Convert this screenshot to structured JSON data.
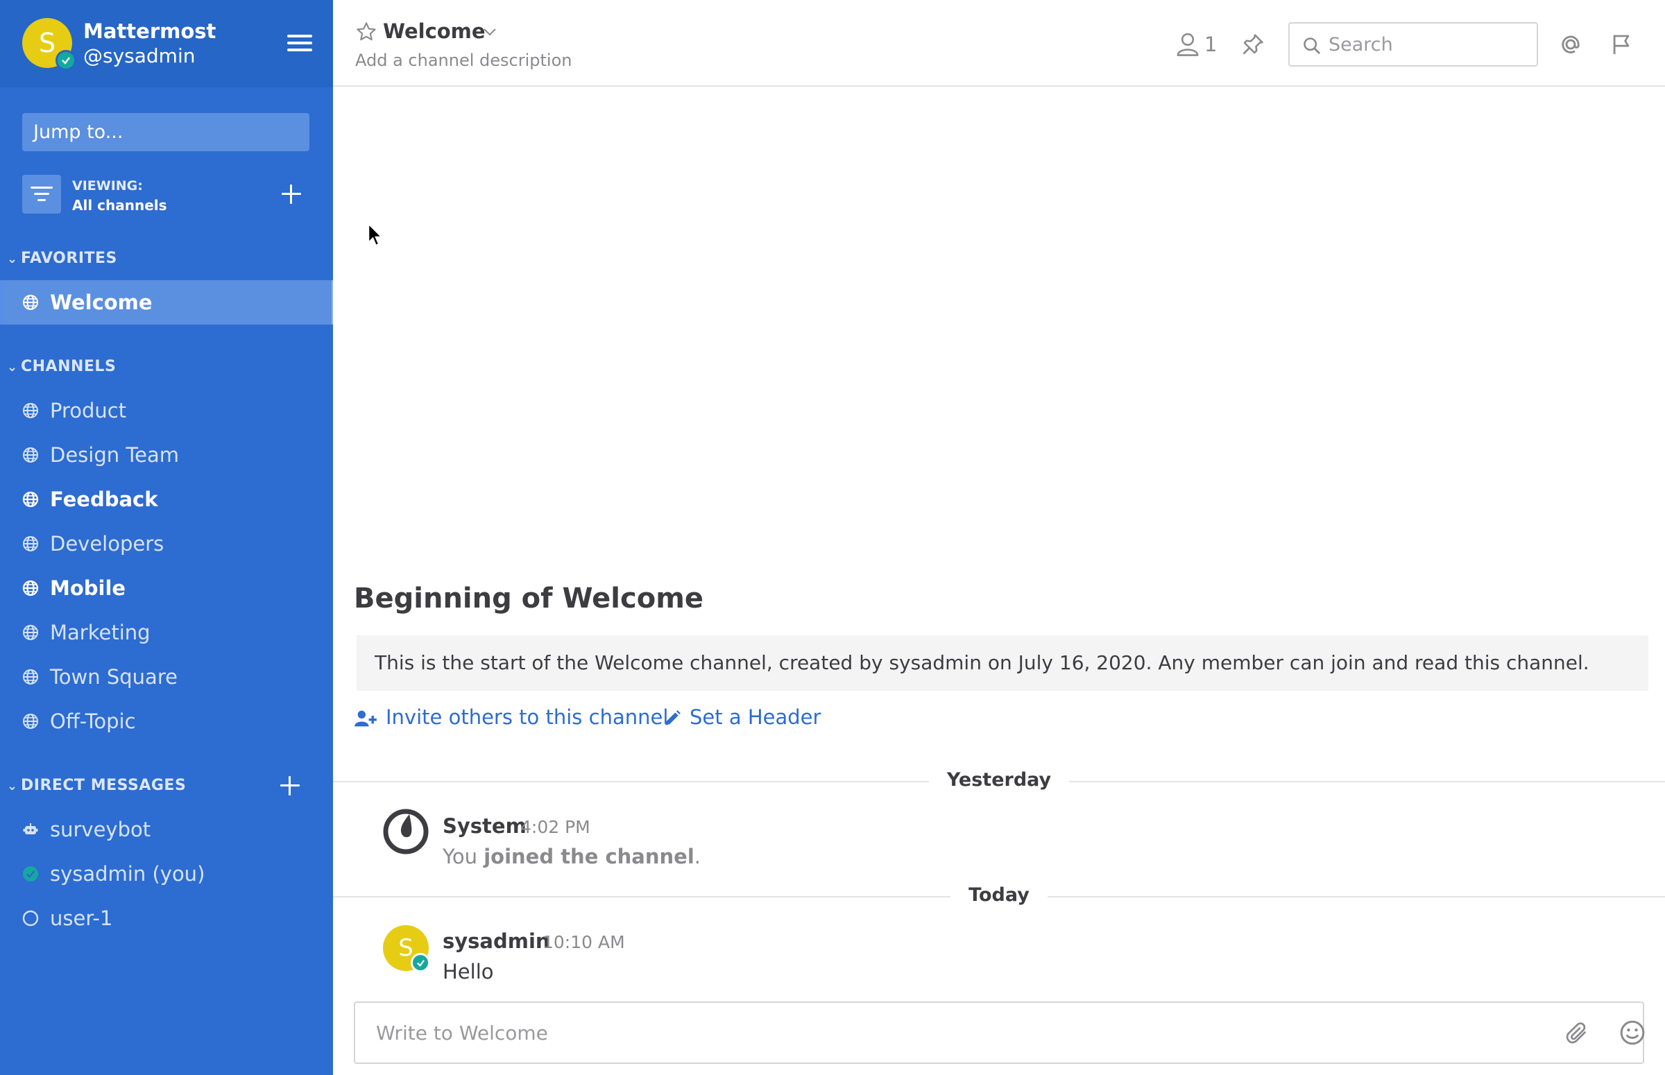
{
  "team": {
    "avatar_letter": "S",
    "name": "Mattermost",
    "username": "@sysadmin"
  },
  "sidebar": {
    "jump_to_placeholder": "Jump to...",
    "viewing_label": "VIEWING:",
    "viewing_value": "All channels",
    "favorites_header": "FAVORITES",
    "favorites": [
      {
        "label": "Welcome",
        "icon": "globe-icon",
        "active": true
      }
    ],
    "channels_header": "CHANNELS",
    "channels": [
      {
        "label": "Product",
        "icon": "globe-icon",
        "unread": false
      },
      {
        "label": "Design Team",
        "icon": "globe-icon",
        "unread": false
      },
      {
        "label": "Feedback",
        "icon": "globe-icon",
        "unread": true
      },
      {
        "label": "Developers",
        "icon": "globe-icon",
        "unread": false
      },
      {
        "label": "Mobile",
        "icon": "globe-icon",
        "unread": true
      },
      {
        "label": "Marketing",
        "icon": "globe-icon",
        "unread": false
      },
      {
        "label": "Town Square",
        "icon": "globe-icon",
        "unread": false
      },
      {
        "label": "Off-Topic",
        "icon": "globe-icon",
        "unread": false
      }
    ],
    "dm_header": "DIRECT MESSAGES",
    "direct_messages": [
      {
        "label": "surveybot",
        "icon": "bot-icon"
      },
      {
        "label": "sysadmin (you)",
        "icon": "online-status-icon"
      },
      {
        "label": "user-1",
        "icon": "offline-status-icon"
      }
    ]
  },
  "header": {
    "channel_name": "Welcome",
    "description": "Add a channel description",
    "member_count": "1",
    "search_placeholder": "Search"
  },
  "intro": {
    "title": "Beginning of Welcome",
    "text": "This is the start of the Welcome channel, created by sysadmin on July 16, 2020. Any member can join and read this channel.",
    "invite_label": "Invite others to this channel",
    "set_header_label": "Set a Header"
  },
  "posts": {
    "yesterday_label": "Yesterday",
    "system": {
      "name": "System",
      "time": "4:02 PM",
      "body_prefix": "You ",
      "body_bold": "joined the channel",
      "body_suffix": "."
    },
    "today_label": "Today",
    "sysadmin": {
      "avatar_letter": "S",
      "name": "sysadmin",
      "time": "10:10 AM",
      "body": "Hello"
    }
  },
  "composer": {
    "placeholder": "Write to Welcome"
  },
  "colors": {
    "sidebar_bg": "#2d6cd1",
    "sidebar_header_bg": "#2566c6",
    "accent_link": "#2d6cd1",
    "online": "#15a89f",
    "avatar_yellow": "#e6cc13"
  }
}
